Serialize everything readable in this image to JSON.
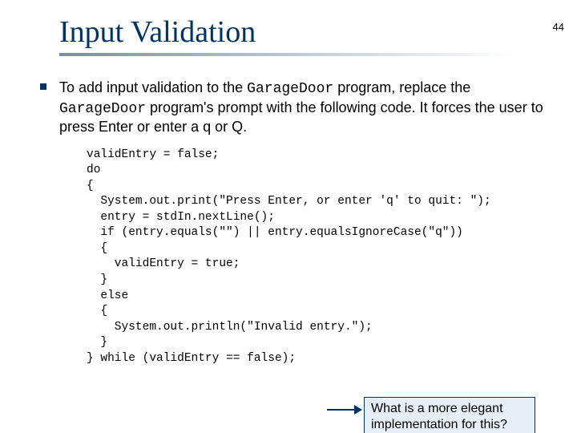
{
  "page_number": "44",
  "title": "Input Validation",
  "para": {
    "t1": "To add input validation to the ",
    "c1": "GarageDoor",
    "t2": " program, replace the ",
    "c2": "GarageDoor",
    "t3": " program's prompt with the following code. It forces the user to press Enter or enter a q or Q."
  },
  "code": {
    "l01": "validEntry = false;",
    "l02": "do",
    "l03": "{",
    "l04": "  System.out.print(\"Press Enter, or enter 'q' to quit: \");",
    "l05": "  entry = stdIn.nextLine();",
    "l06": "  if (entry.equals(\"\") || entry.equalsIgnoreCase(\"q\"))",
    "l07": "  {",
    "l08": "    validEntry = true;",
    "l09": "  }",
    "l10": "  else",
    "l11": "  {",
    "l12": "    System.out.println(\"Invalid entry.\");",
    "l13": "  }",
    "l14": "} while (validEntry == false);"
  },
  "callout": {
    "line1": "What is a more elegant",
    "line2": "implementation for this?"
  }
}
